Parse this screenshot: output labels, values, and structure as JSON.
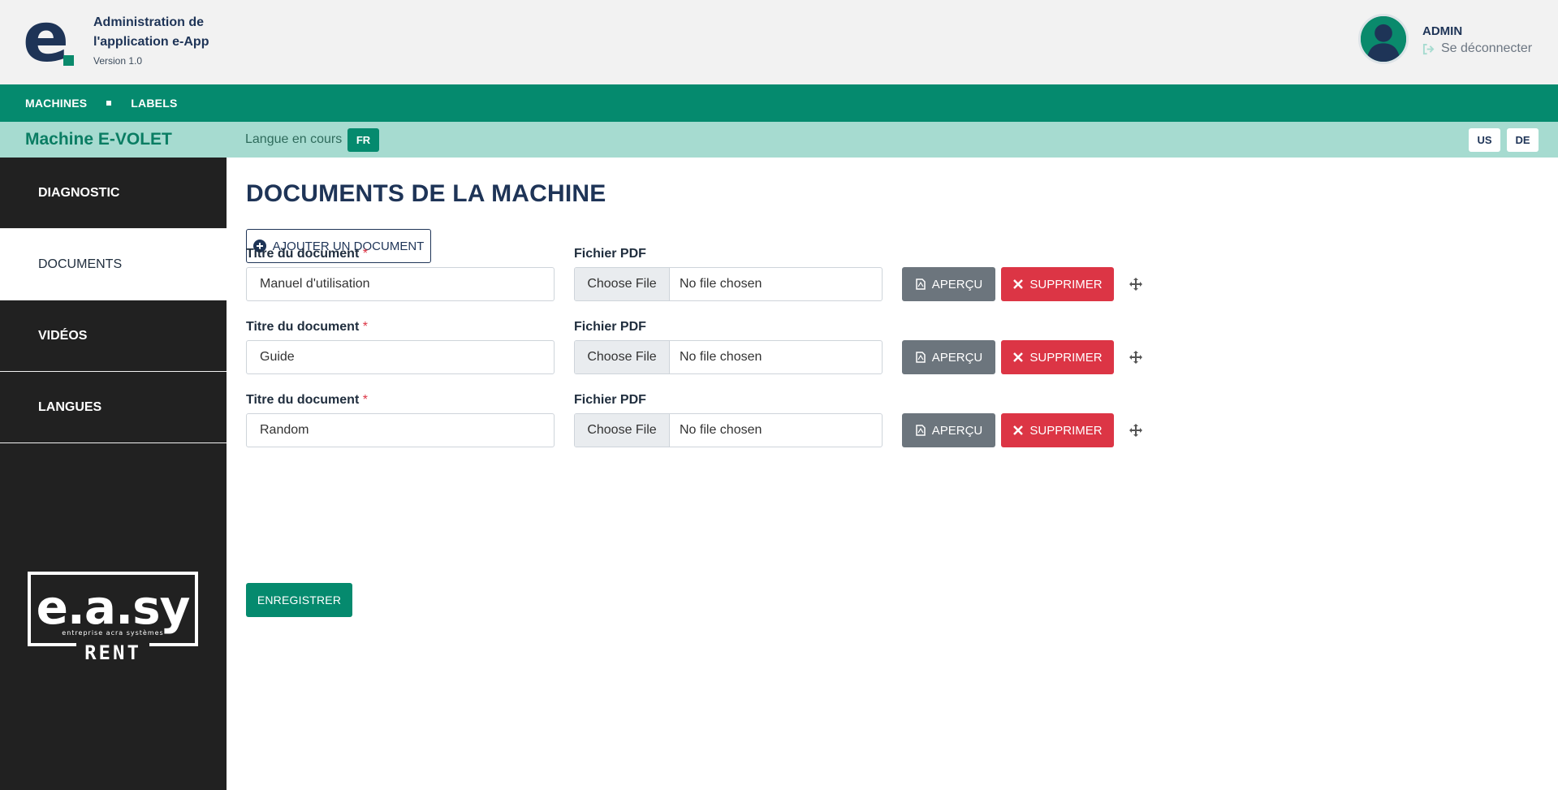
{
  "header": {
    "app_title": "Administration de l'application e-App",
    "version": "Version 1.0",
    "user_name": "ADMIN",
    "logout_label": "Se déconnecter"
  },
  "topnav": {
    "items": [
      {
        "label": "MACHINES"
      },
      {
        "label": "LABELS"
      }
    ]
  },
  "subbar": {
    "machine_title": "Machine E-VOLET",
    "lang_label": "Langue en cours",
    "current_lang": "FR",
    "other_langs": [
      "US",
      "DE"
    ]
  },
  "sidebar": {
    "items": [
      {
        "label": "DIAGNOSTIC"
      },
      {
        "label": "DOCUMENTS"
      },
      {
        "label": "VIDÉOS"
      },
      {
        "label": "LANGUES"
      }
    ],
    "brand_logo_text": "e.a.sy",
    "brand_logo_tagline": "entreprise acra systèmes",
    "brand_logo_sub": "RENT"
  },
  "main": {
    "page_title": "DOCUMENTS DE LA MACHINE",
    "add_button": "AJOUTER UN DOCUMENT",
    "title_label": "Titre du document",
    "required_mark": "*",
    "file_label": "Fichier PDF",
    "choose_file": "Choose File",
    "no_file": "No file chosen",
    "preview_label": "APERÇU",
    "delete_label": "SUPPRIMER",
    "documents": [
      {
        "title": "Manuel d'utilisation"
      },
      {
        "title": "Guide"
      },
      {
        "title": "Random"
      }
    ],
    "save_button": "ENREGISTRER"
  },
  "colors": {
    "primary_green": "#058a6e",
    "light_green": "#a6dbd0",
    "navy": "#1e3457",
    "sidebar_bg": "#212121",
    "danger": "#dc3545",
    "secondary": "#6c757d"
  }
}
